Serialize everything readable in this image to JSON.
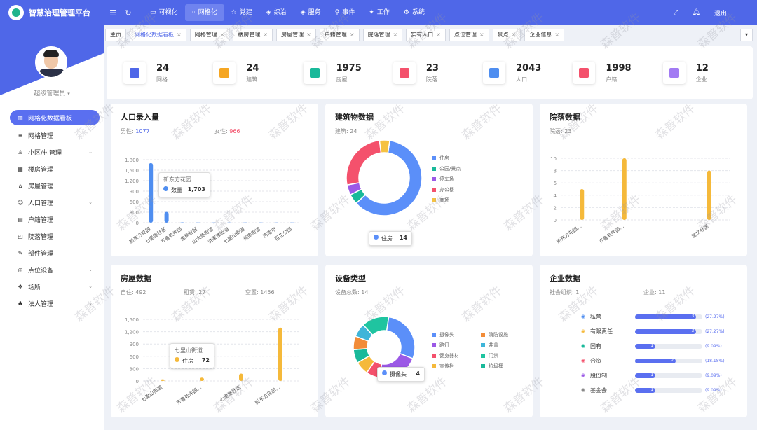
{
  "app": {
    "title": "智慧治理管理平台"
  },
  "topnav": [
    {
      "label": "可视化",
      "icon": "monitor-icon"
    },
    {
      "label": "网格化",
      "icon": "grid-icon",
      "active": true
    },
    {
      "label": "党建",
      "icon": "star-icon"
    },
    {
      "label": "综治",
      "icon": "shield-icon"
    },
    {
      "label": "服务",
      "icon": "service-icon"
    },
    {
      "label": "事件",
      "icon": "pin-icon"
    },
    {
      "label": "工作",
      "icon": "gear-icon"
    },
    {
      "label": "系统",
      "icon": "settings-icon"
    }
  ],
  "topright": {
    "logout": "退出"
  },
  "tabs": [
    {
      "label": "主页",
      "closable": false
    },
    {
      "label": "网格化数据看板",
      "closable": true,
      "active": true
    },
    {
      "label": "网格管理",
      "closable": true
    },
    {
      "label": "楼房管理",
      "closable": true
    },
    {
      "label": "房屋管理",
      "closable": true
    },
    {
      "label": "户籍管理",
      "closable": true
    },
    {
      "label": "院落管理",
      "closable": true
    },
    {
      "label": "实有人口",
      "closable": true
    },
    {
      "label": "点位管理",
      "closable": true
    },
    {
      "label": "景点",
      "closable": true
    },
    {
      "label": "企业信息",
      "closable": true
    }
  ],
  "user": {
    "name": "超级管理员"
  },
  "menu": [
    {
      "label": "网格化数据看板",
      "active": true,
      "icon": "chart-icon"
    },
    {
      "label": "网格管理",
      "icon": "list-icon"
    },
    {
      "label": "小区/村管理",
      "icon": "community-icon",
      "children": true
    },
    {
      "label": "楼房管理",
      "icon": "building-icon"
    },
    {
      "label": "房屋管理",
      "icon": "house-icon"
    },
    {
      "label": "人口管理",
      "icon": "person-icon",
      "children": true
    },
    {
      "label": "户籍管理",
      "icon": "card-icon"
    },
    {
      "label": "院落管理",
      "icon": "yard-icon"
    },
    {
      "label": "部件管理",
      "icon": "wrench-icon"
    },
    {
      "label": "点位设备",
      "icon": "location-icon",
      "children": true
    },
    {
      "label": "场所",
      "icon": "place-icon",
      "children": true
    },
    {
      "label": "法人管理",
      "icon": "legal-icon",
      "children": true
    }
  ],
  "stats": [
    {
      "value": "24",
      "label": "网格",
      "color": "#4f67e8",
      "bg": "#e8ecfd"
    },
    {
      "value": "24",
      "label": "建筑",
      "color": "#f5a623",
      "bg": "#fef3e0"
    },
    {
      "value": "1975",
      "label": "房屋",
      "color": "#19b99a",
      "bg": "#e0f7f2"
    },
    {
      "value": "23",
      "label": "院落",
      "color": "#f4516c",
      "bg": "#fde7eb"
    },
    {
      "value": "2043",
      "label": "人口",
      "color": "#4f8ef0",
      "bg": "#e6f0fe"
    },
    {
      "value": "1998",
      "label": "户籍",
      "color": "#f4516c",
      "bg": "#fde7eb"
    },
    {
      "value": "12",
      "label": "企业",
      "color": "#a27bf3",
      "bg": "#f1ebfe"
    }
  ],
  "cards": {
    "population": {
      "title": "人口录入量",
      "male_label": "男性:",
      "male_value": "1077",
      "female_label": "女性:",
      "female_value": "966"
    },
    "building": {
      "title": "建筑物数据",
      "sub_label": "建筑:",
      "sub_value": "24"
    },
    "yard": {
      "title": "院落数据",
      "sub_label": "院落:",
      "sub_value": "23"
    },
    "house": {
      "title": "房屋数据",
      "s1_label": "自住:",
      "s1_value": "492",
      "s2_label": "租赁:",
      "s2_value": "27",
      "s3_label": "空置:",
      "s3_value": "1456"
    },
    "device": {
      "title": "设备类型",
      "sub_label": "设备总数:",
      "sub_value": "14"
    },
    "enterprise": {
      "title": "企业数据",
      "s1_label": "社会组织:",
      "s1_value": "1",
      "s2_label": "企业:",
      "s2_value": "11"
    }
  },
  "chart_data": [
    {
      "type": "bar",
      "title": "人口录入量",
      "categories": [
        "新东方花园",
        "七里堡社区",
        "齐鲁软件园",
        "金柳社区",
        "山大路街道",
        "洪家楼街道",
        "七里山街道",
        "燕南街道",
        "济南市",
        "百花公园"
      ],
      "values": [
        1703,
        310,
        10,
        5,
        5,
        5,
        5,
        5,
        5,
        5
      ],
      "ylim": [
        0,
        1800
      ],
      "yticks": [
        "0",
        "300",
        "600",
        "900",
        "1,200",
        "1,500",
        "1,800"
      ],
      "tooltip": {
        "title": "新东方花园",
        "label": "数量",
        "value": "1,703"
      },
      "color": "#4f8ef0"
    },
    {
      "type": "pie",
      "title": "建筑物数据",
      "donut": true,
      "series": [
        {
          "name": "住房",
          "value": 14,
          "color": "#5b8ff9"
        },
        {
          "name": "公园/景点",
          "value": 1,
          "color": "#19b99a"
        },
        {
          "name": "停车场",
          "value": 1,
          "color": "#9b59e6"
        },
        {
          "name": "办公楼",
          "value": 6,
          "color": "#f4516c"
        },
        {
          "name": "商场",
          "value": 1,
          "color": "#f5c242"
        }
      ],
      "tooltip": {
        "label": "住房",
        "value": "14"
      }
    },
    {
      "type": "bar",
      "title": "院落数据",
      "categories": [
        "新东方花园",
        "齐鲁软件园",
        "",
        "堂文社区"
      ],
      "values": [
        5,
        10,
        0,
        8
      ],
      "ylim": [
        0,
        10
      ],
      "yticks": [
        "0",
        "2",
        "4",
        "6",
        "8",
        "10"
      ],
      "xticklabels": [
        "新东方花园...",
        "齐鲁软件园...",
        "",
        "堂文社区"
      ],
      "color": "#f5b93a"
    },
    {
      "type": "bar",
      "title": "房屋数据",
      "categories": [
        "七里山街道",
        "齐鲁软件园",
        "七里堡社区",
        "新东方花园"
      ],
      "values": [
        40,
        80,
        180,
        1300
      ],
      "ylim": [
        0,
        1500
      ],
      "yticks": [
        "0",
        "300",
        "600",
        "900",
        "1,200",
        "1,500"
      ],
      "xticklabels": [
        "七里山街道",
        "齐鲁软件园...",
        "七里堡社区",
        "新东方花园..."
      ],
      "tooltip": {
        "title": "七里山街道",
        "label": "住房",
        "value": "72"
      },
      "color": "#f5b93a"
    },
    {
      "type": "pie",
      "title": "设备类型",
      "donut": true,
      "series": [
        {
          "name": "摄像头",
          "value": 4,
          "color": "#5b8ff9"
        },
        {
          "name": "路灯",
          "value": 3,
          "color": "#9b59e6"
        },
        {
          "name": "健身器材",
          "value": 1,
          "color": "#f4516c"
        },
        {
          "name": "宣传栏",
          "value": 1,
          "color": "#f5b93a"
        },
        {
          "name": "垃圾桶",
          "value": 1,
          "color": "#19b99a"
        },
        {
          "name": "消防设施",
          "value": 1,
          "color": "#f28c38"
        },
        {
          "name": "井盖",
          "value": 1,
          "color": "#3fb5d9"
        },
        {
          "name": "门禁",
          "value": 2,
          "color": "#1fc4a0"
        }
      ],
      "tooltip": {
        "label": "摄像头",
        "value": "4"
      }
    },
    {
      "type": "bar",
      "orientation": "horizontal",
      "title": "企业数据",
      "categories": [
        "私营",
        "有限责任",
        "国有",
        "合资",
        "股份制",
        "基金会"
      ],
      "values": [
        3,
        3,
        1,
        2,
        1,
        1
      ],
      "percent_labels": [
        "(27.27%)",
        "(27.27%)",
        "(9.09%)",
        "(18.18%)",
        "(9.09%)",
        "(9.09%)"
      ],
      "icon_colors": [
        "#4f8ef0",
        "#f5b93a",
        "#19b99a",
        "#f4516c",
        "#9b59e6",
        "#888888"
      ]
    }
  ],
  "watermark": "森普软件"
}
